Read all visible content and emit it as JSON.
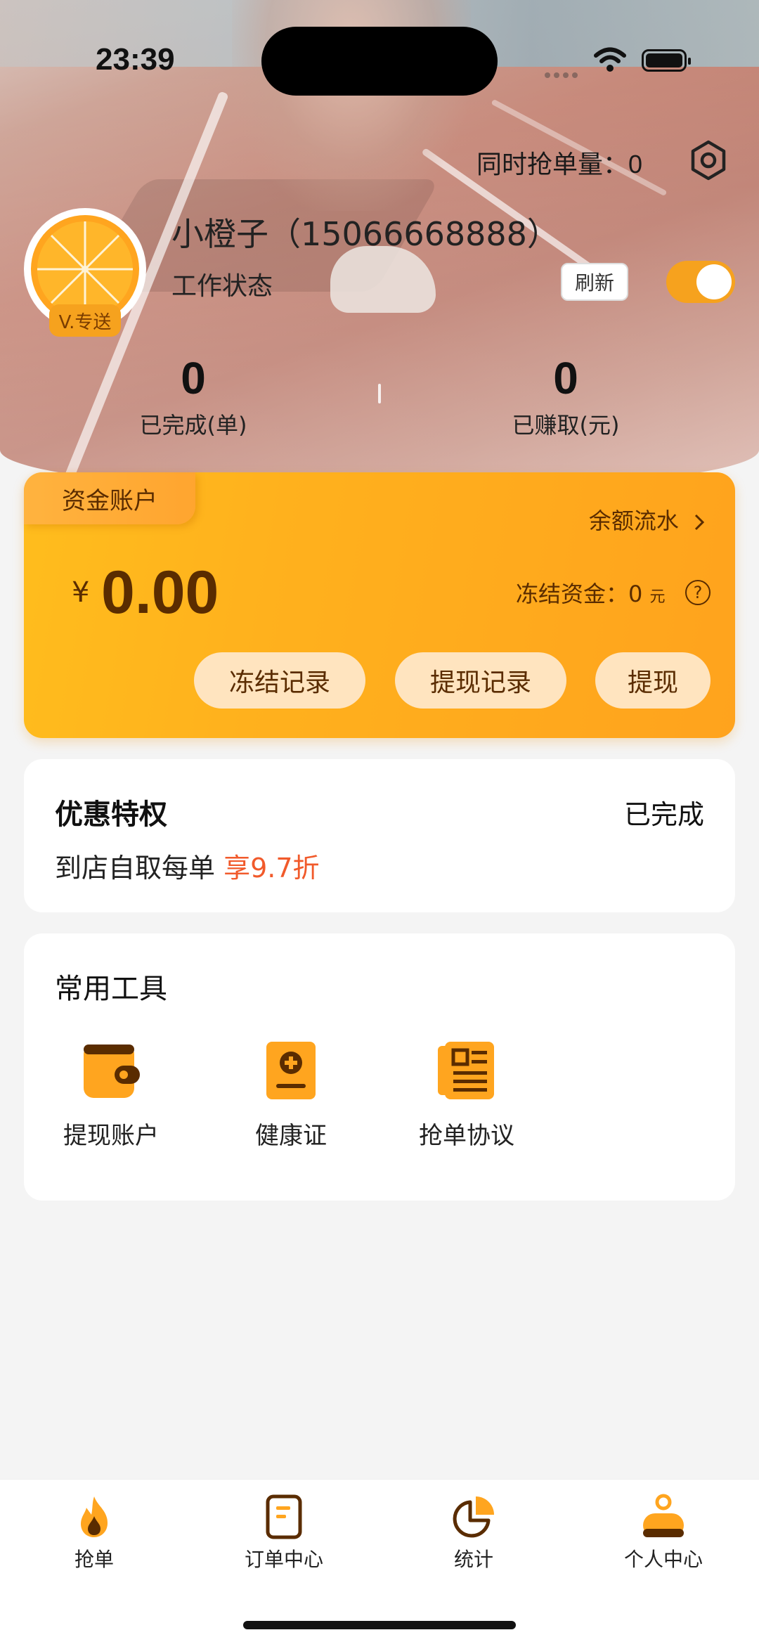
{
  "status_bar": {
    "time": "23:39"
  },
  "header": {
    "concurrent_label": "同时抢单量：",
    "concurrent_value": "0",
    "avatar_badge": "V.专送",
    "username": "小橙子（15066668888）",
    "work_status_label": "工作状态",
    "refresh_label": "刷新",
    "work_toggle_on": true,
    "stats": [
      {
        "value": "0",
        "label": "已完成(单)"
      },
      {
        "value": "0",
        "label": "已赚取(元)"
      }
    ]
  },
  "fund": {
    "tag": "资金账户",
    "flow_link": "余额流水",
    "currency": "¥",
    "balance": "0.00",
    "frozen_label": "冻结资金：",
    "frozen_value": "0",
    "frozen_unit": "元",
    "buttons": {
      "frozen_records": "冻结记录",
      "withdraw_records": "提现记录",
      "withdraw": "提现"
    }
  },
  "privilege": {
    "title": "优惠特权",
    "status": "已完成",
    "desc_prefix": "到店自取每单",
    "desc_highlight": "享9.7折"
  },
  "tools": {
    "title": "常用工具",
    "items": [
      {
        "label": "提现账户",
        "icon": "wallet-icon"
      },
      {
        "label": "健康证",
        "icon": "health-certificate-icon"
      },
      {
        "label": "抢单协议",
        "icon": "agreement-document-icon"
      }
    ]
  },
  "tabbar": {
    "items": [
      {
        "label": "抢单",
        "icon": "flame-icon"
      },
      {
        "label": "订单中心",
        "icon": "order-list-icon"
      },
      {
        "label": "统计",
        "icon": "pie-chart-icon"
      },
      {
        "label": "个人中心",
        "icon": "person-icon"
      }
    ]
  },
  "colors": {
    "accent": "#f6a21e",
    "card_text": "#5a2c00",
    "highlight": "#f15a2b"
  }
}
